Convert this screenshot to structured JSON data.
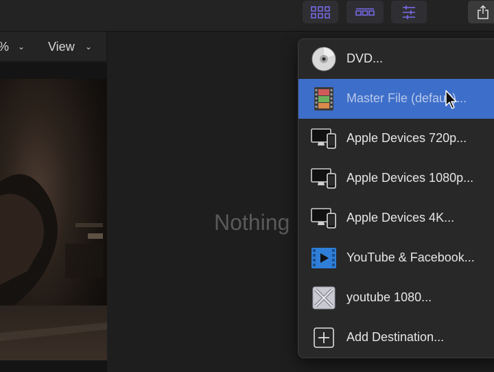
{
  "viewer": {
    "zoom_label": "%",
    "view_label": "View"
  },
  "empty_message": "Nothing",
  "share_menu": {
    "items": [
      {
        "label": "DVD...",
        "icon": "dvd-disc-icon"
      },
      {
        "label": "Master File (default)...",
        "icon": "master-file-filmstrip-icon",
        "selected": true
      },
      {
        "label": "Apple Devices 720p...",
        "icon": "apple-devices-icon"
      },
      {
        "label": "Apple Devices 1080p...",
        "icon": "apple-devices-icon"
      },
      {
        "label": "Apple Devices 4K...",
        "icon": "apple-devices-icon"
      },
      {
        "label": "YouTube & Facebook...",
        "icon": "youtube-facebook-icon"
      },
      {
        "label": "youtube 1080...",
        "icon": "compressor-icon"
      },
      {
        "label": "Add Destination...",
        "icon": "add-destination-icon"
      }
    ]
  },
  "colors": {
    "selected_row": "#3d6ec9",
    "toolbar_icon_accent": "#7b6cf0"
  }
}
